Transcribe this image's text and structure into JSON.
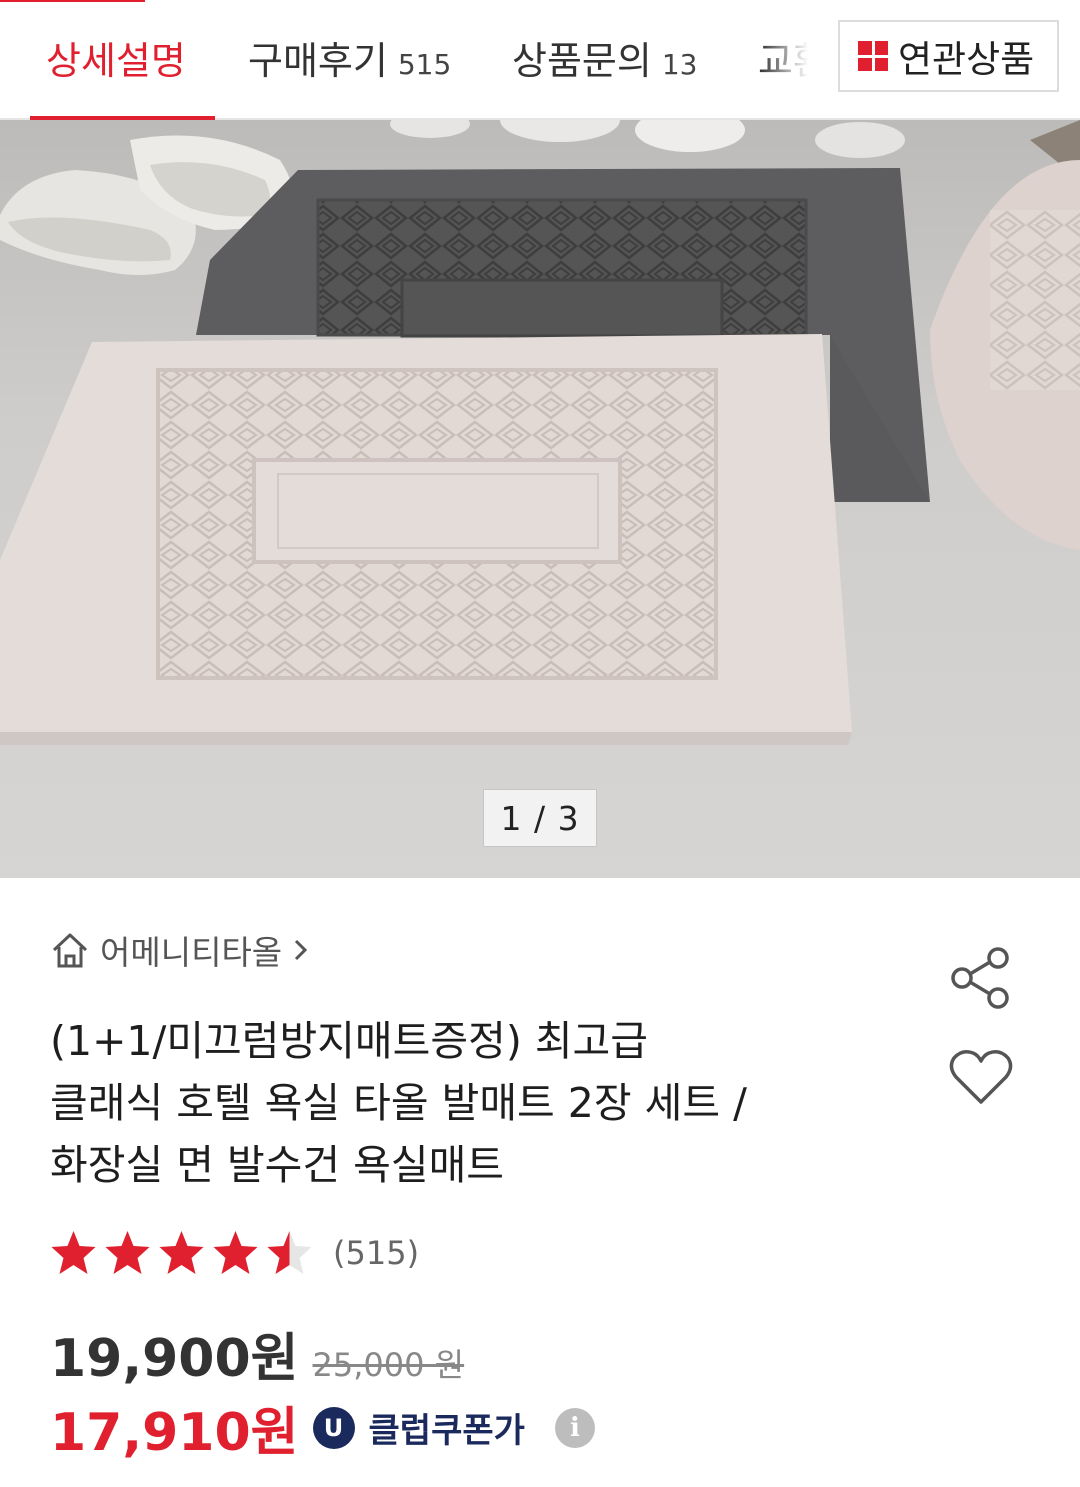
{
  "tabs": [
    {
      "label": "상세설명",
      "count": ""
    },
    {
      "label": "구매후기",
      "count": "515"
    },
    {
      "label": "상품문의",
      "count": "13"
    },
    {
      "label": "교환",
      "count": ""
    }
  ],
  "related_button": {
    "label": "연관상품",
    "icon": "grid-icon"
  },
  "gallery": {
    "current": "1",
    "separator": "/",
    "total": "3"
  },
  "breadcrumb": {
    "icon": "home-icon",
    "label": "어메니티타올"
  },
  "product": {
    "title_lines": [
      "(1+1/미끄럼방지매트증정) 최고급",
      "클래식 호텔 욕실 타올 발매트 2장 세트 /",
      "화장실 면 발수건 욕실매트"
    ],
    "rating": {
      "value": 4.5,
      "max": 5,
      "count_text": "(515)"
    },
    "price": {
      "sale": "19,900원",
      "original": "25,000 원"
    },
    "coupon": {
      "badge": "U",
      "price": "17,910원",
      "label": "클럽쿠폰가",
      "info_icon": "i"
    }
  },
  "colors": {
    "accent": "#e0202e",
    "club": "#1b2a5c",
    "star": "#e0202e"
  }
}
